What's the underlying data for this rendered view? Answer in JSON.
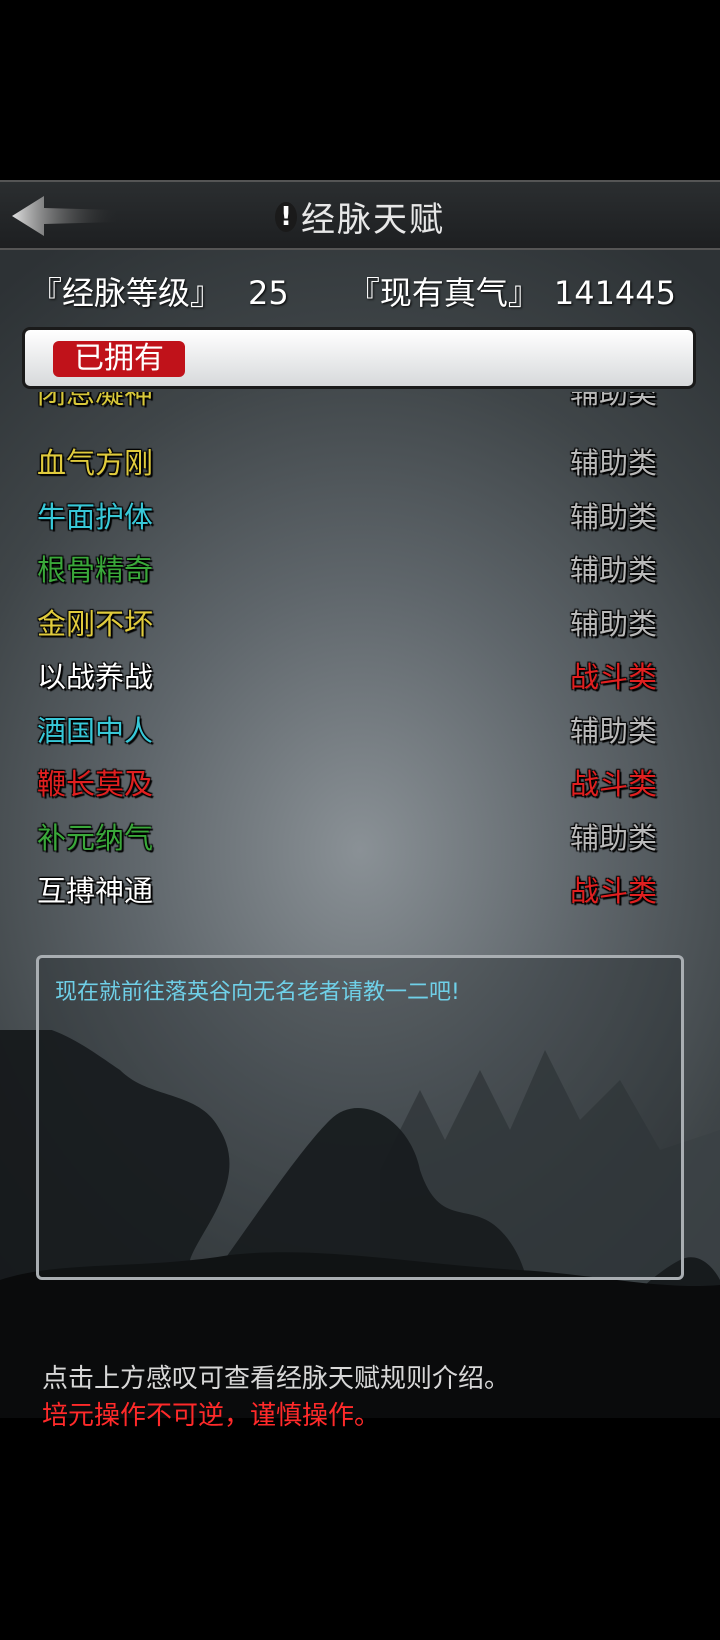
{
  "header": {
    "title": "经脉天赋",
    "help_symbol": "!"
  },
  "stats": {
    "level_label": "『经脉等级』",
    "level_value": "25",
    "qi_label": "『现有真气』",
    "qi_value": "141445"
  },
  "tabs": {
    "owned_label": "已拥有"
  },
  "talents": [
    {
      "name": "闭息凝神",
      "category": "辅助类",
      "name_color": "#d8c83a",
      "cat_color": "#b9b9b9"
    },
    {
      "name": "血气方刚",
      "category": "辅助类",
      "name_color": "#e0cb3d",
      "cat_color": "#b9b9b9"
    },
    {
      "name": "牛面护体",
      "category": "辅助类",
      "name_color": "#38c8d8",
      "cat_color": "#b9b9b9"
    },
    {
      "name": "根骨精奇",
      "category": "辅助类",
      "name_color": "#3aa83a",
      "cat_color": "#b9b9b9"
    },
    {
      "name": "金刚不坏",
      "category": "辅助类",
      "name_color": "#e0cb3d",
      "cat_color": "#b9b9b9"
    },
    {
      "name": "以战养战",
      "category": "战斗类",
      "name_color": "#ffffff",
      "cat_color": "#e02020"
    },
    {
      "name": "酒国中人",
      "category": "辅助类",
      "name_color": "#38c8d8",
      "cat_color": "#b9b9b9"
    },
    {
      "name": "鞭长莫及",
      "category": "战斗类",
      "name_color": "#e02020",
      "cat_color": "#e02020"
    },
    {
      "name": "补元纳气",
      "category": "辅助类",
      "name_color": "#3aa83a",
      "cat_color": "#b9b9b9"
    },
    {
      "name": "互搏神通",
      "category": "战斗类",
      "name_color": "#ffffff",
      "cat_color": "#e02020"
    }
  ],
  "message": "现在就前往落英谷向无名老者请教一二吧!",
  "hints": {
    "info": "点击上方感叹可查看经脉天赋规则介绍。",
    "warning": "培元操作不可逆，谨慎操作。"
  }
}
